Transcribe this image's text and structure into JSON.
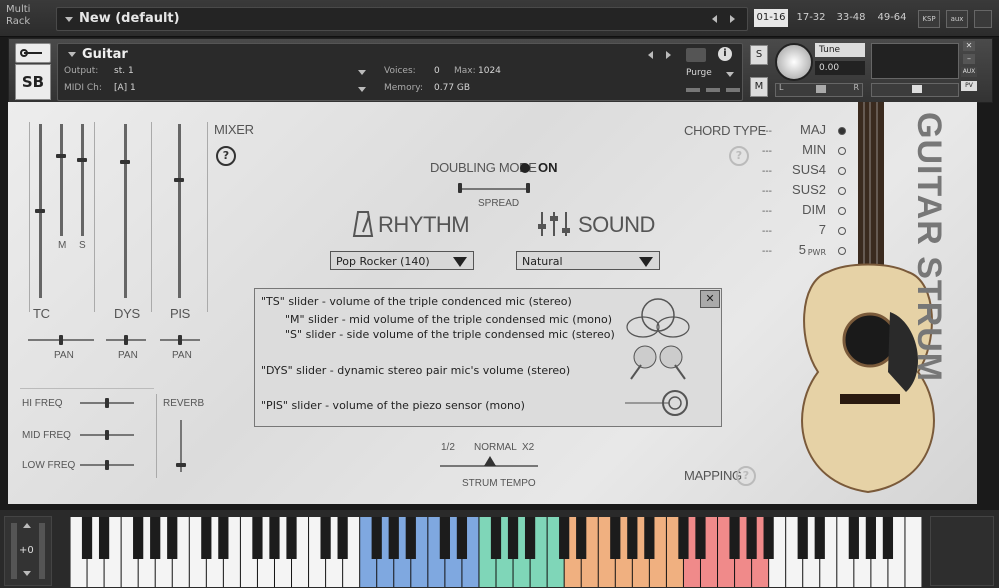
{
  "rack": {
    "label": "Multi Rack",
    "preset": "New (default)",
    "ranges": [
      "01-16",
      "17-32",
      "33-48",
      "49-64"
    ],
    "active_range": "01-16",
    "buttons": [
      "KSP",
      "aux"
    ]
  },
  "instrument": {
    "name": "Guitar",
    "output_label": "Output:",
    "output_value": "st. 1",
    "midi_label": "MIDI Ch:",
    "midi_value": "[A]  1",
    "voices_label": "Voices:",
    "voices_value": "0",
    "max_label": "Max:",
    "max_value": "1024",
    "memory_label": "Memory:",
    "memory_value": "0.77 GB",
    "purge_label": "Purge",
    "solo": "S",
    "mute": "M",
    "tune_label": "Tune",
    "tune_value": "0.00",
    "pan_l": "L",
    "pan_r": "R",
    "aux": "AUX",
    "pv": "PV"
  },
  "mixer": {
    "title": "MIXER",
    "help": "?",
    "fader_labels": {
      "tc": "TC",
      "m": "M",
      "s": "S",
      "dys": "DYS",
      "pis": "PIS"
    },
    "pan_label": "PAN",
    "eq": [
      "HI FREQ",
      "MID FREQ",
      "LOW FREQ"
    ],
    "reverb": "REVERB"
  },
  "doubling": {
    "label": "DOUBLING MODE",
    "state": "ON",
    "spread": "SPREAD"
  },
  "rhythm": {
    "label": "RHYTHM",
    "value": "Pop Rocker (140)"
  },
  "sound": {
    "label": "SOUND",
    "value": "Natural"
  },
  "chord_type": {
    "title": "CHORD TYPE",
    "help": "?",
    "items": [
      "MAJ",
      "MIN",
      "SUS4",
      "SUS2",
      "DIM",
      "7",
      "5"
    ],
    "dashes": "---",
    "pwr_suffix": "PWR",
    "selected": "MAJ"
  },
  "help_popup": {
    "close": "✕",
    "lines": [
      "\"TS\" slider - volume of the  triple condenced mic (stereo)",
      "\"M\" slider - mid volume of the triple condensed mic (mono)",
      "\"S\" slider - side volume of the triple condensed mic (stereo)",
      "\"DYS\" slider - dynamic stereo pair mic's volume (stereo)",
      "\"PIS\" slider - volume of the piezo sensor (mono)"
    ]
  },
  "tempo": {
    "half": "1/2",
    "normal": "NORMAL",
    "double": "X2",
    "label": "STRUM TEMPO"
  },
  "mapping": {
    "label": "MAPPING",
    "help": "?"
  },
  "product_title": "GUITAR STRUM",
  "keyboard": {
    "octave": "+0"
  },
  "colors": {
    "blue_keys": "#7fa8e0",
    "green_keys": "#7fd6b8",
    "orange_keys": "#f0b080",
    "red_keys": "#f08a8a"
  }
}
